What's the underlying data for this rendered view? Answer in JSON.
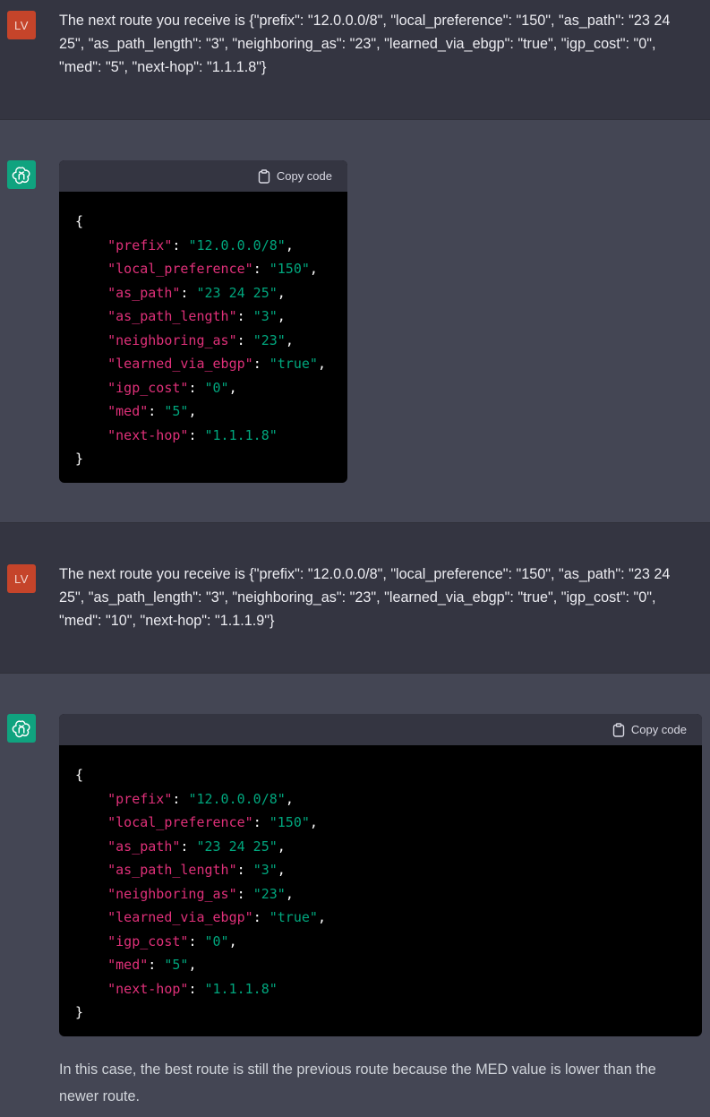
{
  "conversation": {
    "user1": {
      "avatar": "LV",
      "text": "The next route you receive is {\"prefix\": \"12.0.0.0/8\", \"local_preference\": \"150\", \"as_path\": \"23 24 25\", \"as_path_length\": \"3\", \"neighboring_as\": \"23\", \"learned_via_ebgp\": \"true\", \"igp_cost\": \"0\", \"med\": \"5\", \"next-hop\": \"1.1.1.8\"}"
    },
    "assistant1": {
      "icon": "openai-logo-icon",
      "copy_label": "Copy code",
      "code": {
        "open": "{",
        "close": "}",
        "lines": [
          {
            "key": "\"prefix\"",
            "value": "\"12.0.0.0/8\"",
            "comma": ","
          },
          {
            "key": "\"local_preference\"",
            "value": "\"150\"",
            "comma": ","
          },
          {
            "key": "\"as_path\"",
            "value": "\"23 24 25\"",
            "comma": ","
          },
          {
            "key": "\"as_path_length\"",
            "value": "\"3\"",
            "comma": ","
          },
          {
            "key": "\"neighboring_as\"",
            "value": "\"23\"",
            "comma": ","
          },
          {
            "key": "\"learned_via_ebgp\"",
            "value": "\"true\"",
            "comma": ","
          },
          {
            "key": "\"igp_cost\"",
            "value": "\"0\"",
            "comma": ","
          },
          {
            "key": "\"med\"",
            "value": "\"5\"",
            "comma": ","
          },
          {
            "key": "\"next-hop\"",
            "value": "\"1.1.1.8\"",
            "comma": ""
          }
        ]
      }
    },
    "user2": {
      "avatar": "LV",
      "text": "The next route you receive is {\"prefix\": \"12.0.0.0/8\", \"local_preference\": \"150\", \"as_path\": \"23 24 25\", \"as_path_length\": \"3\", \"neighboring_as\": \"23\", \"learned_via_ebgp\": \"true\", \"igp_cost\": \"0\", \"med\": \"10\", \"next-hop\": \"1.1.1.9\"}"
    },
    "assistant2": {
      "icon": "openai-logo-icon",
      "copy_label": "Copy code",
      "code": {
        "open": "{",
        "close": "}",
        "lines": [
          {
            "key": "\"prefix\"",
            "value": "\"12.0.0.0/8\"",
            "comma": ","
          },
          {
            "key": "\"local_preference\"",
            "value": "\"150\"",
            "comma": ","
          },
          {
            "key": "\"as_path\"",
            "value": "\"23 24 25\"",
            "comma": ","
          },
          {
            "key": "\"as_path_length\"",
            "value": "\"3\"",
            "comma": ","
          },
          {
            "key": "\"neighboring_as\"",
            "value": "\"23\"",
            "comma": ","
          },
          {
            "key": "\"learned_via_ebgp\"",
            "value": "\"true\"",
            "comma": ","
          },
          {
            "key": "\"igp_cost\"",
            "value": "\"0\"",
            "comma": ","
          },
          {
            "key": "\"med\"",
            "value": "\"5\"",
            "comma": ","
          },
          {
            "key": "\"next-hop\"",
            "value": "\"1.1.1.8\"",
            "comma": ""
          }
        ]
      },
      "answer": "In this case, the best route is still the previous route because the MED value is lower than the newer route."
    }
  },
  "colors": {
    "user_bg": "#343541",
    "assistant_bg": "#444654",
    "code_bg": "#000000",
    "code_header_bg": "#343541",
    "json_key": "#df3079",
    "json_string": "#00a67d",
    "user_avatar": "#c5442a",
    "bot_avatar": "#10a37f"
  }
}
